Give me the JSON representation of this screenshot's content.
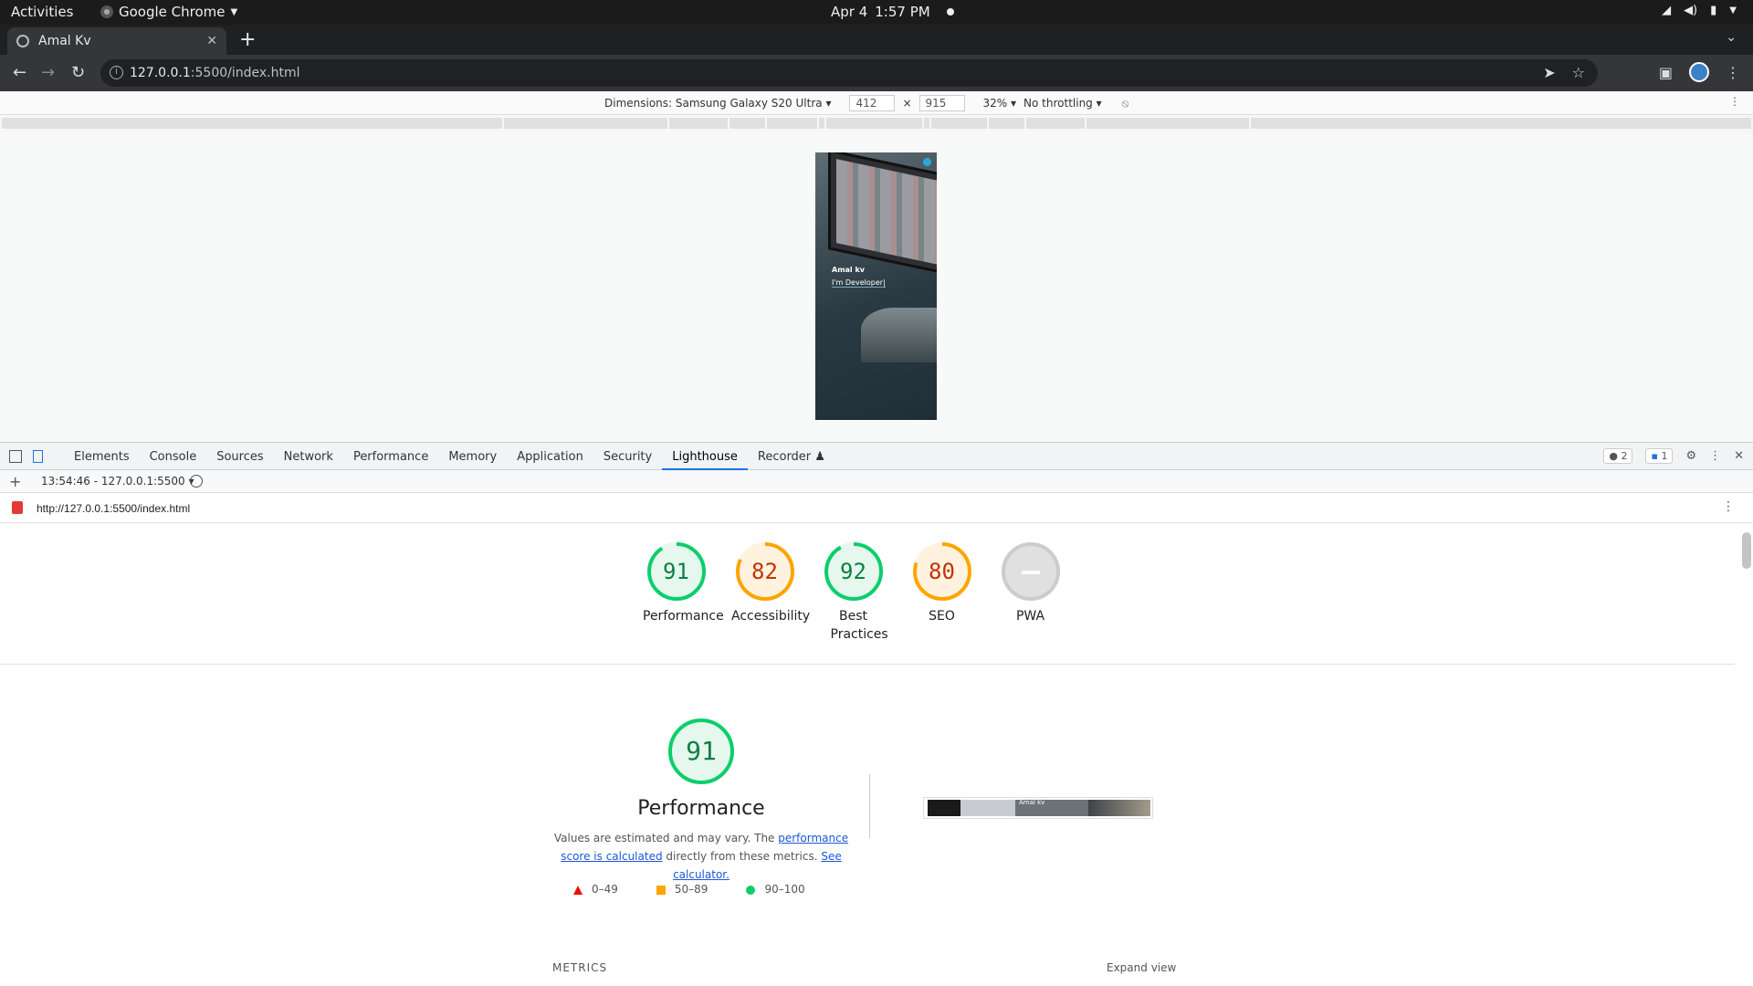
{
  "os": {
    "activities": "Activities",
    "app_name": "Google Chrome",
    "date": "Apr 4",
    "time": "1:57 PM"
  },
  "browser": {
    "tab_title": "Amal Kv",
    "url_host": "127.0.0.1",
    "url_path": ":5500/index.html"
  },
  "device_toolbar": {
    "dimensions_label": "Dimensions: Samsung Galaxy S20 Ultra",
    "width": "412",
    "times": "×",
    "height": "915",
    "zoom": "32%",
    "throttling": "No throttling"
  },
  "preview": {
    "name": "Amal kv",
    "role": "I'm Developer|"
  },
  "devtools": {
    "tabs": [
      "Elements",
      "Console",
      "Sources",
      "Network",
      "Performance",
      "Memory",
      "Application",
      "Security",
      "Lighthouse",
      "Recorder"
    ],
    "active_tab": "Lighthouse",
    "error_count": "2",
    "message_count": "1",
    "report_selector": "13:54:46 - 127.0.0.1:5500",
    "report_url": "http://127.0.0.1:5500/index.html"
  },
  "scores": [
    {
      "label": "Performance",
      "value": "91",
      "color": "#0cce6b",
      "text_color": "#0b8043",
      "fill": "#e6f8ee"
    },
    {
      "label": "Accessibility",
      "value": "82",
      "color": "#ffa400",
      "text_color": "#c33300",
      "fill": "#fff3e0"
    },
    {
      "label": "Best Practices",
      "value": "92",
      "color": "#0cce6b",
      "text_color": "#0b8043",
      "fill": "#e6f8ee"
    },
    {
      "label": "SEO",
      "value": "80",
      "color": "#ffa400",
      "text_color": "#c33300",
      "fill": "#fff3e0"
    },
    {
      "label": "PWA",
      "value": "",
      "color": "#cccccc",
      "text_color": "#777777",
      "fill": "#e0e0e0"
    }
  ],
  "performance": {
    "score": "91",
    "title": "Performance",
    "desc_1": "Values are estimated and may vary. The ",
    "link_1": "performance score is calculated",
    "desc_2": " directly from these metrics. ",
    "link_2": "See calculator.",
    "legend": [
      "0–49",
      "50–89",
      "90–100"
    ],
    "filmstrip_text": "Amal kv",
    "metrics_label": "METRICS",
    "expand_label": "Expand view"
  }
}
